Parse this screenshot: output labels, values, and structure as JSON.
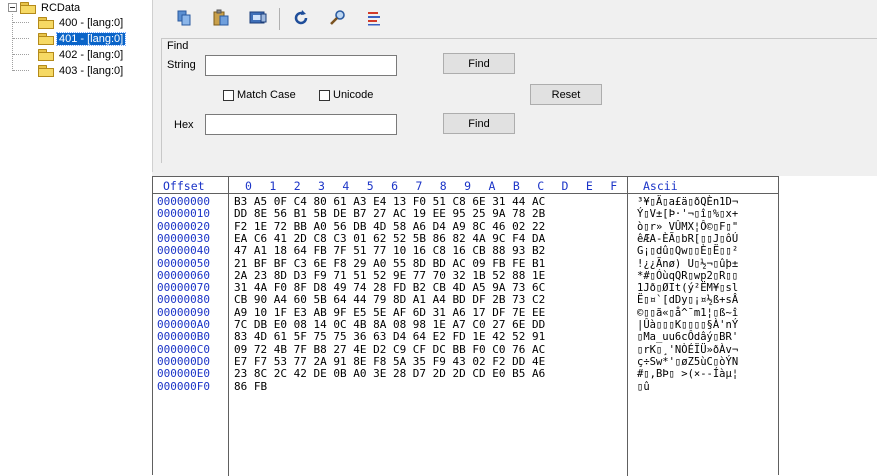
{
  "tree": {
    "root": "RCData",
    "children": [
      {
        "label": "400 - [lang:0]",
        "selected": false
      },
      {
        "label": "401 - [lang:0]",
        "selected": true
      },
      {
        "label": "402 - [lang:0]",
        "selected": false
      },
      {
        "label": "403 - [lang:0]",
        "selected": false
      }
    ]
  },
  "toolbar": {
    "icons": [
      "copy-icon",
      "paste-icon",
      "select-all-icon",
      "refresh-icon",
      "find-icon",
      "options-icon"
    ]
  },
  "find": {
    "group_title": "Find",
    "string_label": "String",
    "string_value": "",
    "find_button": "Find",
    "match_case_label": "Match Case",
    "unicode_label": "Unicode",
    "reset_button": "Reset",
    "hex_label": "Hex",
    "hex_value": "",
    "find_hex_button": "Find"
  },
  "hexview": {
    "offset_header": "Offset",
    "byte_headers": [
      "0",
      "1",
      "2",
      "3",
      "4",
      "5",
      "6",
      "7",
      "8",
      "9",
      "A",
      "B",
      "C",
      "D",
      "E",
      "F"
    ],
    "ascii_header": "Ascii",
    "rows": [
      {
        "offset": "00000000",
        "hex": "B3 A5 0F C4 80 61 A3 E4 13 F0 51 C8 6E 31 44 AC",
        "ascii": "³¥▯Ä▯a£ä▯ðQÈn1D¬"
      },
      {
        "offset": "00000010",
        "hex": "DD 8E 56 B1 5B DE B7 27 AC 19 EE 95 25 9A 78 2B",
        "ascii": "Ý▯V±[Þ·'¬▯î▯%▯x+"
      },
      {
        "offset": "00000020",
        "hex": "F2 1E 72 BB A0 56 DB 4D 58 A6 D4 A9 8C 46 02 22",
        "ascii": "ò▯r» VÛMX¦Ô©▯F▯\""
      },
      {
        "offset": "00000030",
        "hex": "EA C6 41 2D C8 C3 01 62 52 5B 86 82 4A 9C F4 DA",
        "ascii": "êÆA-ÈÃ▯bR[▯▯J▯ôÚ"
      },
      {
        "offset": "00000040",
        "hex": "47 A1 18 64 FB 7F 51 77 10 16 C8 16 CB 88 93 B2",
        "ascii": "G¡▯dû▯Qw▯▯È▯Ë▯▯²"
      },
      {
        "offset": "00000050",
        "hex": "21 BF BF C3 6E F8 29 A0 55 8D BD AC 09 FB FE B1",
        "ascii": "!¿¿Ãnø) U▯½¬▯ûþ±"
      },
      {
        "offset": "00000060",
        "hex": "2A 23 8D D3 F9 71 51 52 9E 77 70 32 1B 52 88 1E",
        "ascii": "*#▯ÓùqQR▯wp2▯R▯▯"
      },
      {
        "offset": "00000070",
        "hex": "31 4A F0 8F D8 49 74 28 FD B2 CB 4D A5 9A 73 6C",
        "ascii": "1Jð▯ØIt(ý²ËM¥▯sl"
      },
      {
        "offset": "00000080",
        "hex": "CB 90 A4 60 5B 64 44 79 8D A1 A4 BD DF 2B 73 C2",
        "ascii": "Ë▯¤`[dDy▯¡¤½ß+sÂ"
      },
      {
        "offset": "00000090",
        "hex": "A9 10 1F E3 AB 9F E5 5E AF 6D 31 A6 17 DF 7E EE",
        "ascii": "©▯▯ã«▯å^¯m1¦▯ß~î"
      },
      {
        "offset": "000000A0",
        "hex": "7C DB E0 08 14 0C 4B 8A 08 98 1E A7 C0 27 6E DD",
        "ascii": "|Ûà▯▯▯K▯▯▯▯§À'nÝ"
      },
      {
        "offset": "000000B0",
        "hex": "83 4D 61 5F 75 75 36 63 D4 64 E2 FD 1E 42 52 91",
        "ascii": "▯Ma_uu6cÔdâý▯BR'"
      },
      {
        "offset": "000000C0",
        "hex": "09 72 4B 7F B8 27 4E D2 C9 CF DC BB F0 C0 76 AC",
        "ascii": "▯rK▯¸'NÒÉÏÜ»ðÀv¬"
      },
      {
        "offset": "000000D0",
        "hex": "E7 F7 53 77 2A 91 8E F8 5A 35 F9 43 02 F2 DD 4E",
        "ascii": "ç÷Sw*'▯øZ5ùC▯òÝN"
      },
      {
        "offset": "000000E0",
        "hex": "23 8C 2C 42 DE 0B A0 3E 28 D7 2D 2D CD E0 B5 A6",
        "ascii": "#▯,BÞ▯ >(×--Íàµ¦"
      },
      {
        "offset": "000000F0",
        "hex": "86 FB",
        "ascii": "▯û"
      }
    ]
  }
}
